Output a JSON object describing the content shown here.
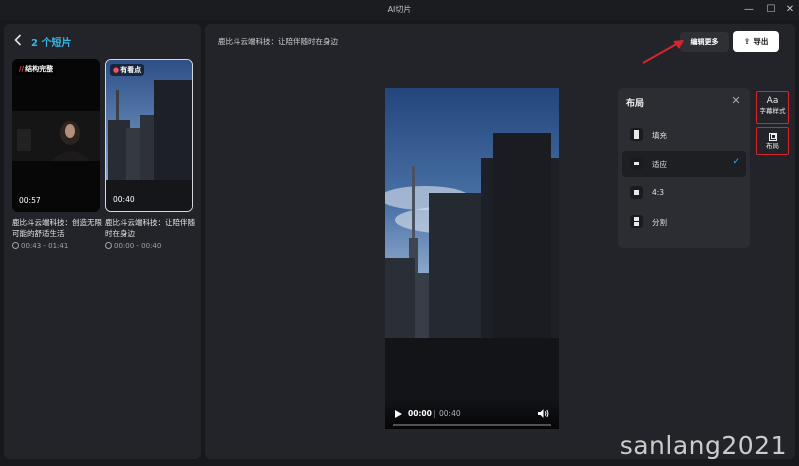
{
  "window": {
    "title": "AI切片",
    "controls": {
      "minimize": "—",
      "maximize": "☐",
      "close": "✕"
    }
  },
  "sidebar": {
    "back_icon": "chevron-left-icon",
    "clip_count": "2 个短片",
    "clips": [
      {
        "tag_mark": "//",
        "tag": "结构完整",
        "duration": "00:57",
        "title": "鹿比斗云端科技：创造无限可能的舒适生活",
        "range": "00:43 - 01:41"
      },
      {
        "tag_mark": "●",
        "tag": "有看点",
        "duration": "00:40",
        "title": "鹿比斗云端科技：让陪伴随时在身边",
        "range": "00:00 - 00:40"
      }
    ],
    "collapse_icon": "❯"
  },
  "main": {
    "video_title": "鹿比斗云端科技：让陪伴随时在身边",
    "edit_more_label": "编辑更多",
    "export_label": "导出",
    "export_icon": "upload-icon",
    "player": {
      "current_time": "00:00",
      "separator": "|",
      "total_time": "00:40",
      "progress": 0
    },
    "layout_popup": {
      "title": "布局",
      "close_icon": "✕",
      "options": [
        {
          "label": "填充",
          "selected": false
        },
        {
          "label": "适应",
          "selected": true
        },
        {
          "label": "4:3",
          "selected": false
        },
        {
          "label": "分割",
          "selected": false
        }
      ],
      "check_icon": "✓"
    },
    "side_tools": {
      "font_glyph": "Aa",
      "font_label": "字幕样式",
      "layout_label": "布局"
    }
  },
  "colors": {
    "accent": "#36b7e8",
    "highlight_box": "#d8232a"
  },
  "watermark": "sanlang2021"
}
